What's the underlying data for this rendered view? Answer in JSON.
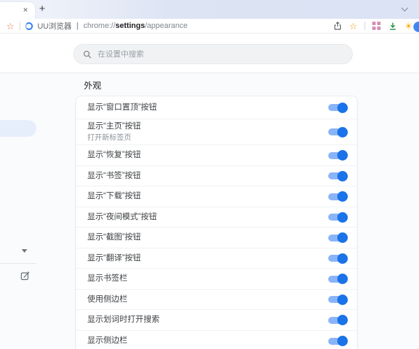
{
  "browser": {
    "tab": {
      "close_icon": "×",
      "new_tab_icon": "+"
    },
    "toolbar": {
      "brand": "UU浏览器",
      "separator": "|",
      "url_prefix": "chrome://",
      "url_bold": "settings",
      "url_suffix": "/appearance",
      "bookmark_star_icon": "☆",
      "favorite_star_icon": "☆",
      "sun_icon": "☀"
    }
  },
  "search": {
    "placeholder": "在设置中搜索"
  },
  "page": {
    "section_title": "外观"
  },
  "settings": {
    "rows": [
      {
        "label": "显示“窗口置顶”按钮",
        "toggle": true
      },
      {
        "label": "显示“主页”按钮",
        "sublabel": "打开新标签页",
        "toggle": true
      },
      {
        "label": "显示“恢复”按钮",
        "toggle": true
      },
      {
        "label": "显示“书签”按钮",
        "toggle": true
      },
      {
        "label": "显示“下载”按钮",
        "toggle": true
      },
      {
        "label": "显示“夜间模式”按钮",
        "toggle": true
      },
      {
        "label": "显示“截图”按钮",
        "toggle": true
      },
      {
        "label": "显示“翻译”按钮",
        "toggle": true
      },
      {
        "label": "显示书签栏",
        "toggle": true
      },
      {
        "label": "使用侧边栏",
        "toggle": true
      },
      {
        "label": "显示划词时打开搜索",
        "toggle": true
      },
      {
        "label": "显示侧边栏",
        "toggle": true
      }
    ]
  },
  "colors": {
    "toggle_track": "#8ab4f8",
    "toggle_knob": "#1a73e8",
    "highlight_pill": "#e7eefb",
    "download_green": "#1e8e3e",
    "grid_pink": "#d98fb5",
    "sun_yellow": "#f9ab00",
    "logo_blue": "#2d7ff9",
    "star_orange": "#e8734f"
  }
}
